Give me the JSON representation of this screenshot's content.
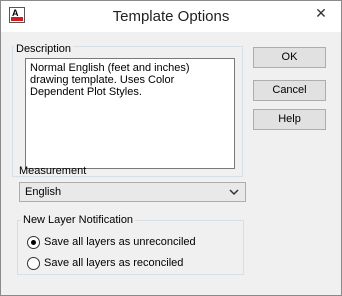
{
  "window": {
    "title": "Template Options",
    "close_glyph": "✕",
    "app_icon": "autocad-icon"
  },
  "description": {
    "label": "Description",
    "text": "Normal English (feet and inches) drawing template. Uses Color Dependent Plot Styles."
  },
  "buttons": {
    "ok": "OK",
    "cancel": "Cancel",
    "help": "Help"
  },
  "measurement": {
    "label": "Measurement",
    "selected": "English"
  },
  "layer_notification": {
    "label": "New Layer Notification",
    "options": [
      {
        "label": "Save all layers as unreconciled",
        "checked": true
      },
      {
        "label": "Save all layers as reconciled",
        "checked": false
      }
    ]
  },
  "colors": {
    "app_icon_red": "#d21e1e",
    "dialog_bg": "#f0f0f0"
  }
}
